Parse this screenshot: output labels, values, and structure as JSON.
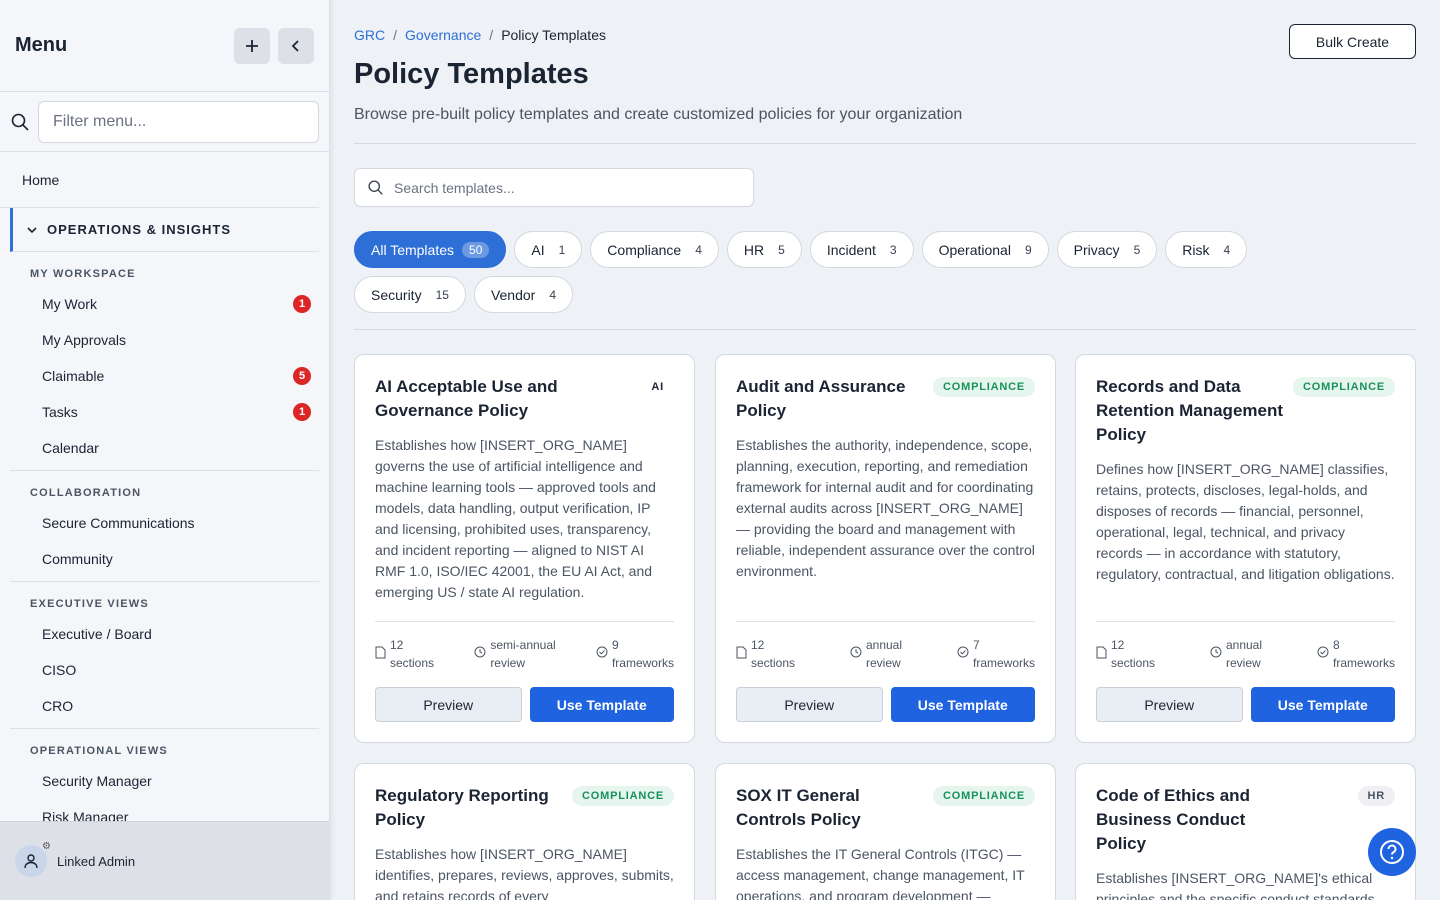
{
  "sidebar": {
    "title": "Menu",
    "filter_placeholder": "Filter menu...",
    "home": "Home",
    "group": "OPERATIONS & INSIGHTS",
    "sections": [
      {
        "title": "MY WORKSPACE",
        "items": [
          {
            "label": "My Work",
            "badge": "1"
          },
          {
            "label": "My Approvals",
            "badge": ""
          },
          {
            "label": "Claimable",
            "badge": "5"
          },
          {
            "label": "Tasks",
            "badge": "1"
          },
          {
            "label": "Calendar",
            "badge": ""
          }
        ]
      },
      {
        "title": "COLLABORATION",
        "items": [
          {
            "label": "Secure Communications"
          },
          {
            "label": "Community"
          }
        ]
      },
      {
        "title": "EXECUTIVE VIEWS",
        "items": [
          {
            "label": "Executive / Board"
          },
          {
            "label": "CISO"
          },
          {
            "label": "CRO"
          }
        ]
      },
      {
        "title": "OPERATIONAL VIEWS",
        "items": [
          {
            "label": "Security Manager"
          },
          {
            "label": "Risk Manager"
          }
        ]
      }
    ],
    "user": "Linked Admin"
  },
  "breadcrumb": {
    "l1": "GRC",
    "l2": "Governance",
    "current": "Policy Templates",
    "sep": "/"
  },
  "header": {
    "title": "Policy Templates",
    "description": "Browse pre-built policy templates and create customized policies for your organization",
    "bulk_create": "Bulk Create"
  },
  "search": {
    "placeholder": "Search templates..."
  },
  "filters": [
    {
      "label": "All Templates",
      "count": "50"
    },
    {
      "label": "AI",
      "count": "1"
    },
    {
      "label": "Compliance",
      "count": "4"
    },
    {
      "label": "HR",
      "count": "5"
    },
    {
      "label": "Incident",
      "count": "3"
    },
    {
      "label": "Operational",
      "count": "9"
    },
    {
      "label": "Privacy",
      "count": "5"
    },
    {
      "label": "Risk",
      "count": "4"
    },
    {
      "label": "Security",
      "count": "15"
    },
    {
      "label": "Vendor",
      "count": "4"
    }
  ],
  "cards": [
    {
      "title": "AI Acceptable Use and Governance Policy",
      "tag": "AI",
      "description": "Establishes how [INSERT_ORG_NAME] governs the use of artificial intelligence and machine learning tools — approved tools and models, data handling, output verification, IP and licensing, prohibited uses, transparency, and incident reporting — aligned to NIST AI RMF 1.0, ISO/IEC 42001, the EU AI Act, and emerging US / state AI regulation.",
      "sections": "12",
      "sections_label": "sections",
      "review": "semi-annual",
      "review_label": "review",
      "frameworks": "9",
      "frameworks_label": "frameworks"
    },
    {
      "title": "Audit and Assurance Policy",
      "tag": "COMPLIANCE",
      "description": "Establishes the authority, independence, scope, planning, execution, reporting, and remediation framework for internal audit and for coordinating external audits across [INSERT_ORG_NAME] — providing the board and management with reliable, independent assurance over the control environment.",
      "sections": "12",
      "sections_label": "sections",
      "review": "annual",
      "review_label": "review",
      "frameworks": "7",
      "frameworks_label": "frameworks"
    },
    {
      "title": "Records and Data Retention Management Policy",
      "tag": "COMPLIANCE",
      "description": "Defines how [INSERT_ORG_NAME] classifies, retains, protects, discloses, legal-holds, and disposes of records — financial, personnel, operational, legal, technical, and privacy records — in accordance with statutory, regulatory, contractual, and litigation obligations.",
      "sections": "12",
      "sections_label": "sections",
      "review": "annual",
      "review_label": "review",
      "frameworks": "8",
      "frameworks_label": "frameworks"
    },
    {
      "title": "Regulatory Reporting Policy",
      "tag": "COMPLIANCE",
      "description": "Establishes how [INSERT_ORG_NAME] identifies, prepares, reviews, approves, submits, and retains records of every"
    },
    {
      "title": "SOX IT General Controls Policy",
      "tag": "COMPLIANCE",
      "description": "Establishes the IT General Controls (ITGC) — access management, change management, IT operations, and program development —"
    },
    {
      "title": "Code of Ethics and Business Conduct Policy",
      "tag": "HR",
      "description": "Establishes [INSERT_ORG_NAME]'s ethical principles and the specific conduct standards expected of every workforce"
    }
  ],
  "buttons": {
    "preview": "Preview",
    "use": "Use Template"
  },
  "colors": {
    "accent": "#1f63e0",
    "compliance": "#17915a",
    "badge": "#dc2626"
  }
}
